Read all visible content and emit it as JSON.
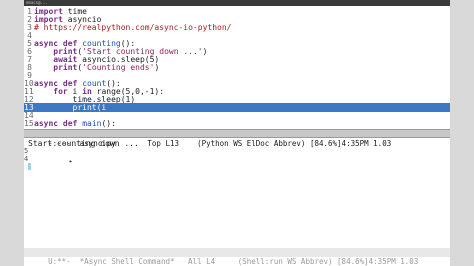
{
  "window": {
    "title": "emacs@..."
  },
  "editor": {
    "lines": [
      {
        "num": "1",
        "parts": [
          {
            "t": "import",
            "c": "kw"
          },
          {
            "t": " time",
            "c": ""
          }
        ]
      },
      {
        "num": "2",
        "parts": [
          {
            "t": "import",
            "c": "kw"
          },
          {
            "t": " asyncio",
            "c": ""
          }
        ]
      },
      {
        "num": "3",
        "parts": [
          {
            "t": "# https://realpython.com/async-io-python/",
            "c": "cmt"
          }
        ]
      },
      {
        "num": "4",
        "parts": []
      },
      {
        "num": "5",
        "parts": [
          {
            "t": "async def",
            "c": "kw"
          },
          {
            "t": " ",
            "c": ""
          },
          {
            "t": "counting",
            "c": "fn"
          },
          {
            "t": "():",
            "c": ""
          }
        ]
      },
      {
        "num": "6",
        "parts": [
          {
            "t": "    ",
            "c": ""
          },
          {
            "t": "print",
            "c": "kw"
          },
          {
            "t": "(",
            "c": ""
          },
          {
            "t": "'Start counting down ...'",
            "c": "str"
          },
          {
            "t": ")",
            "c": ""
          }
        ]
      },
      {
        "num": "7",
        "parts": [
          {
            "t": "    ",
            "c": ""
          },
          {
            "t": "await",
            "c": "kw"
          },
          {
            "t": " asyncio.sleep(5)",
            "c": ""
          }
        ]
      },
      {
        "num": "8",
        "parts": [
          {
            "t": "    ",
            "c": ""
          },
          {
            "t": "print",
            "c": "kw"
          },
          {
            "t": "(",
            "c": ""
          },
          {
            "t": "'Counting ends'",
            "c": "str"
          },
          {
            "t": ")",
            "c": ""
          }
        ]
      },
      {
        "num": "9",
        "parts": []
      },
      {
        "num": "10",
        "parts": [
          {
            "t": "async def",
            "c": "kw"
          },
          {
            "t": " ",
            "c": ""
          },
          {
            "t": "count",
            "c": "fn"
          },
          {
            "t": "():",
            "c": ""
          }
        ]
      },
      {
        "num": "11",
        "parts": [
          {
            "t": "    ",
            "c": ""
          },
          {
            "t": "for",
            "c": "kw"
          },
          {
            "t": " i ",
            "c": ""
          },
          {
            "t": "in",
            "c": "kw"
          },
          {
            "t": " range(5,0,-1):",
            "c": ""
          }
        ]
      },
      {
        "num": "12",
        "parts": [
          {
            "t": "        time.sleep(1)",
            "c": ""
          }
        ]
      },
      {
        "num": "13",
        "parts": [
          {
            "t": "        print(i",
            "c": ""
          }
        ]
      },
      {
        "num": "14",
        "parts": []
      },
      {
        "num": "15",
        "parts": [
          {
            "t": "async def",
            "c": "kw"
          },
          {
            "t": " ",
            "c": ""
          },
          {
            "t": "main",
            "c": "fn"
          },
          {
            "t": "():",
            "c": ""
          }
        ]
      }
    ],
    "highlighted_line": "13"
  },
  "modeline_active": {
    "text": "-:---  async.py       Top L13    (Python WS ElDoc Abbrev) [84.6%]4:35PM 1.03"
  },
  "shell": {
    "lines": [
      {
        "fringe": "",
        "text": "Start counting down ..."
      },
      {
        "fringe": "5",
        "text": ""
      },
      {
        "fringe": "4",
        "text": ""
      }
    ]
  },
  "modeline_inactive": {
    "text": "U:**-  *Async Shell Command*   All L4     (Shell:run WS Abbrev) [84.6%]4:35PM 1.03"
  }
}
